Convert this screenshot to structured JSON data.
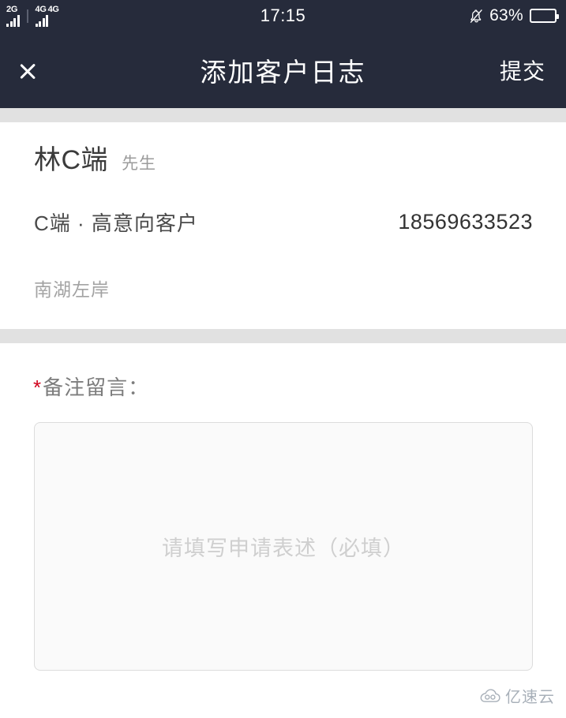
{
  "status_bar": {
    "sim1_network": "2G",
    "sim2_network_a": "4G",
    "sim2_network_b": "4G",
    "data_arrows": "↑↓",
    "time": "17:15",
    "battery_percent": "63%",
    "battery_level": 63,
    "silent_icon": "bell-mute-icon",
    "background_color": "#262b3b"
  },
  "nav_bar": {
    "back_icon": "chevron-left-icon",
    "title": "添加客户日志",
    "action_label": "提交",
    "background_color": "#262b3b"
  },
  "customer": {
    "name": "林C端",
    "honorific": "先生",
    "tags": "C端 · 高意向客户",
    "phone": "18569633523",
    "address": "南湖左岸"
  },
  "form": {
    "required_marker": "*",
    "label": "备注留言：",
    "required_color": "#d0021b",
    "remark_value": "",
    "remark_placeholder": "请填写申请表述（必填）"
  },
  "watermark": {
    "logo_icon": "cloud-logo-icon",
    "text": "亿速云"
  }
}
